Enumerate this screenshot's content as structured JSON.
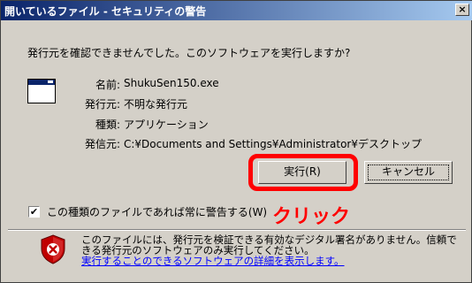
{
  "titlebar": {
    "title": "開いているファイル - セキュリティの警告",
    "close_label": "×"
  },
  "dialog": {
    "question": "発行元を確認できませんでした。このソフトウェアを実行しますか?"
  },
  "file_info": [
    {
      "label": "名前:",
      "value": "ShukuSen150.exe"
    },
    {
      "label": "発行元:",
      "value": "不明な発行元"
    },
    {
      "label": "種類:",
      "value": "アプリケーション"
    },
    {
      "label": "発信元:",
      "value": "C:¥Documents and Settings¥Administrator¥デスクトップ"
    }
  ],
  "buttons": {
    "run_label": "実行(R)",
    "cancel_label": "キャンセル"
  },
  "checkbox": {
    "checked": true,
    "label": "この種類のファイルであれば常に警告する(W)"
  },
  "annotation": {
    "text": "クリック",
    "color": "#ff0000"
  },
  "warning": {
    "line1": "このファイルには、発行元を検証できる有効なデジタル署名がありません。信頼で",
    "line2": "きる発行元のソフトウェアのみ実行してください。",
    "link": "実行することのできるソフトウェアの詳細を表示します。"
  },
  "colors": {
    "titlebar_start": "#0a246a",
    "titlebar_end": "#a6caf0",
    "dialog_bg": "#d4d0c8",
    "link": "#0000ff",
    "highlight": "#ff0000"
  },
  "icons": {
    "app": "application-window-icon",
    "shield": "security-shield-warning-icon",
    "close": "close-icon",
    "check": "checkmark-icon"
  }
}
